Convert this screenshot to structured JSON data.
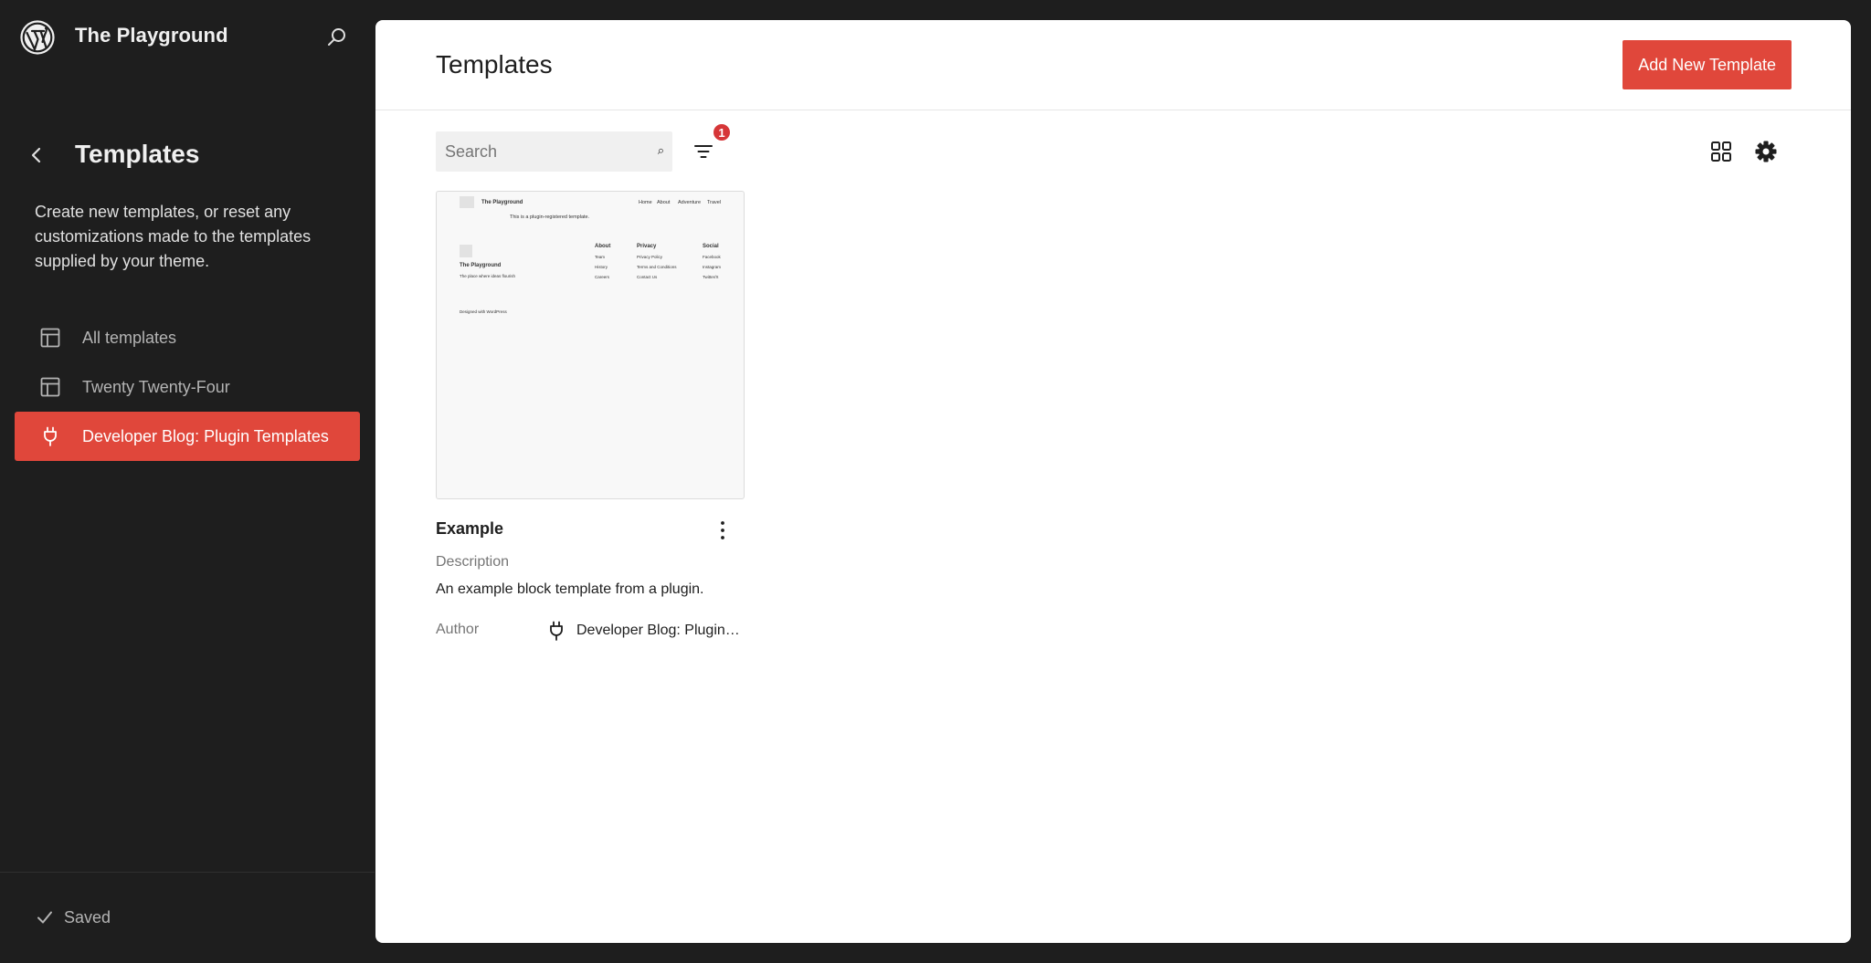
{
  "site": {
    "title": "The Playground"
  },
  "sidebar": {
    "heading": "Templates",
    "description": "Create new templates, or reset any customizations made to the templates supplied by your theme.",
    "items": [
      {
        "label": "All templates",
        "icon": "layout-icon",
        "active": false
      },
      {
        "label": "Twenty Twenty-Four",
        "icon": "layout-icon",
        "active": false
      },
      {
        "label": "Developer Blog: Plugin Templates",
        "icon": "plug-icon",
        "active": true
      }
    ],
    "status": "Saved"
  },
  "main": {
    "title": "Templates",
    "add_button": "Add New Template",
    "search": {
      "placeholder": "Search",
      "value": ""
    },
    "filter_count": "1"
  },
  "preview": {
    "site_title": "The Playground",
    "nav": [
      "Home",
      "About",
      "Adventure",
      "Travel"
    ],
    "banner": "This is a plugin-registered template.",
    "footer_site_title": "The Playground",
    "footer_tagline": "The place where ideas flourish",
    "col1": [
      "About",
      "Team",
      "History",
      "Careers"
    ],
    "col2": [
      "Privacy",
      "Privacy Policy",
      "Terms and Conditions",
      "Contact Us"
    ],
    "col3": [
      "Social",
      "Facebook",
      "Instagram",
      "Twitter/X"
    ],
    "credit": "Designed with WordPress"
  },
  "card": {
    "title": "Example",
    "description_label": "Description",
    "description": "An example block template from a plugin.",
    "author_label": "Author",
    "author": "Developer Blog: Plugin Templates"
  },
  "colors": {
    "accent": "#e0473b",
    "sidebar_bg": "#1e1e1e",
    "badge": "#d63638"
  }
}
